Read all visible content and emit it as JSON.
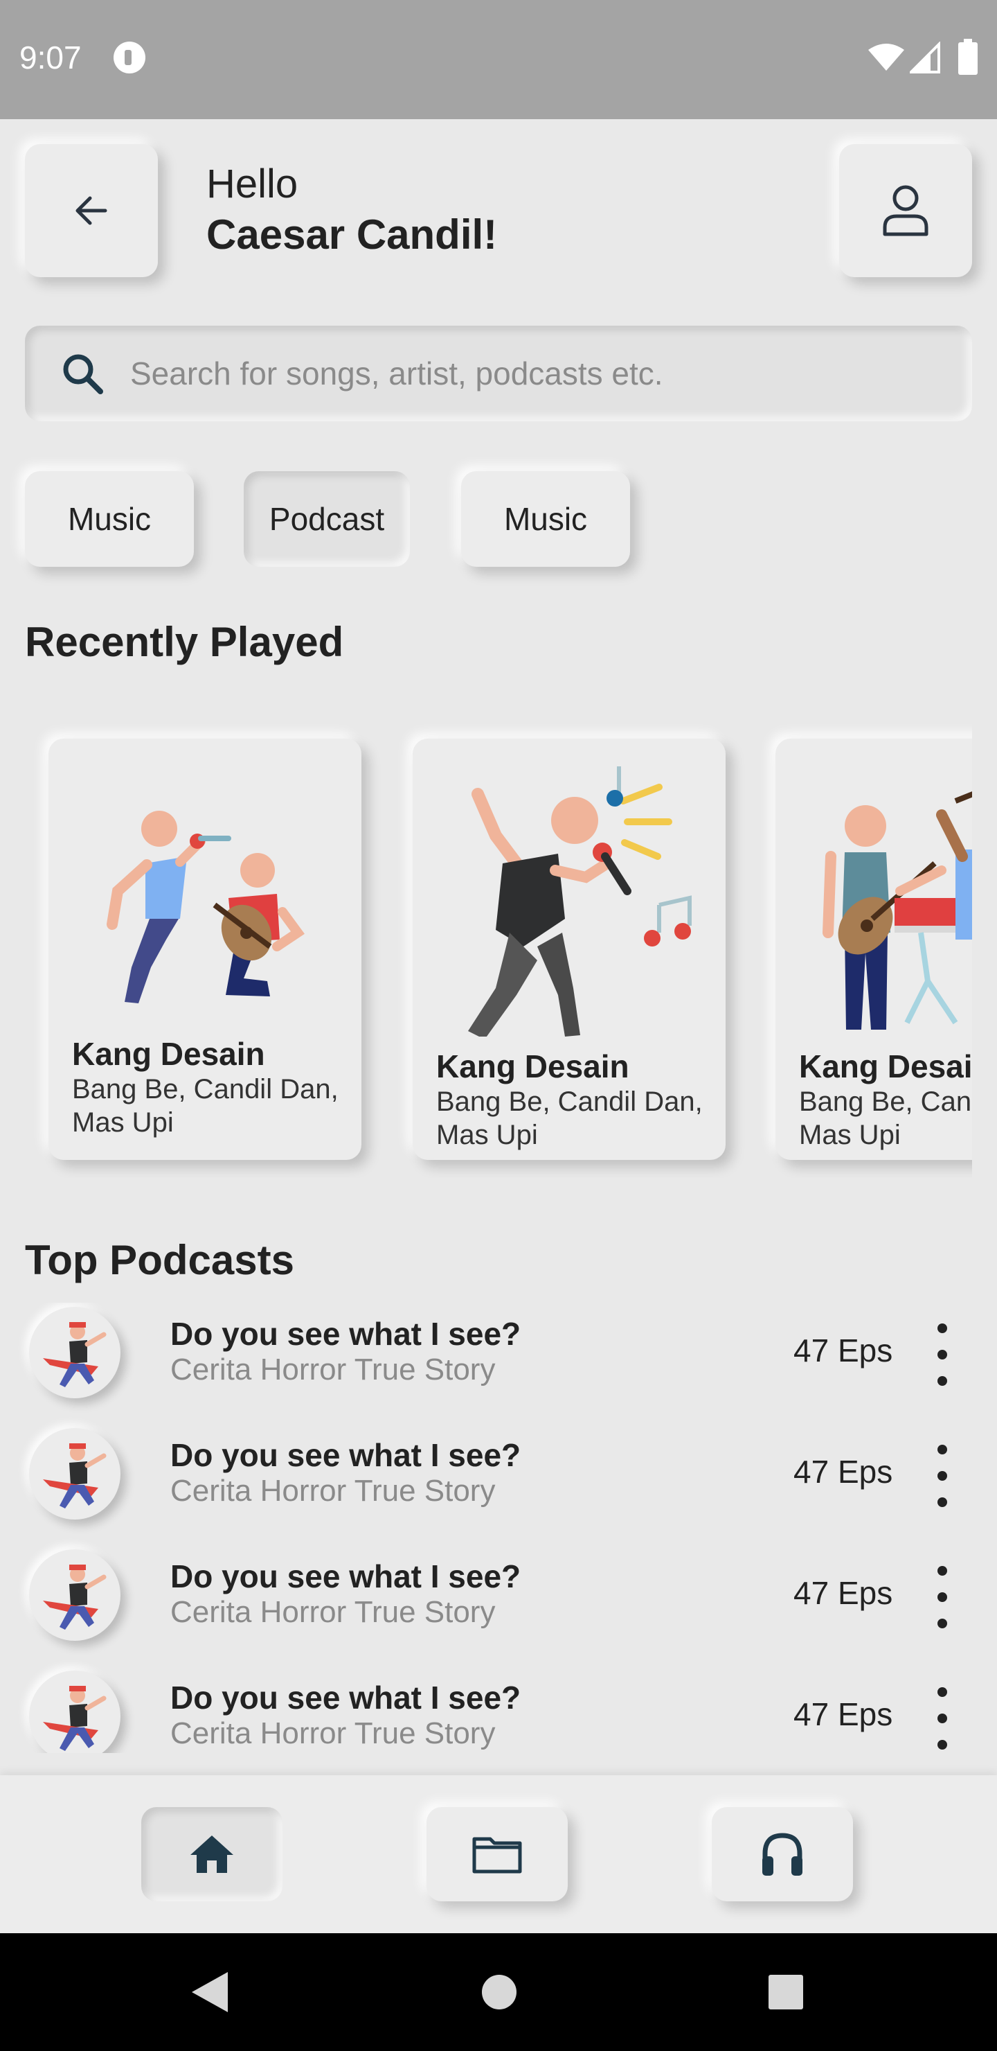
{
  "status_bar": {
    "time": "9:07",
    "icons": [
      "wifi-icon",
      "signal-icon",
      "battery-icon"
    ]
  },
  "header": {
    "greeting": "Hello",
    "user_name": "Caesar Candil!"
  },
  "search": {
    "placeholder": "Search for songs, artist, podcasts etc."
  },
  "chips": [
    {
      "label": "Music",
      "selected": false
    },
    {
      "label": "Podcast",
      "selected": true
    },
    {
      "label": "Music",
      "selected": false
    }
  ],
  "recently_played": {
    "title": "Recently Played",
    "items": [
      {
        "title": "Kang Desain",
        "artists": "Bang Be, Candil Dan, Mas Upi"
      },
      {
        "title": "Kang Desain",
        "artists": "Bang Be, Candil Dan, Mas Upi"
      },
      {
        "title": "Kang Desain",
        "artists": "Bang Be, Candil Dan, Mas Upi"
      }
    ]
  },
  "top_podcasts": {
    "title": "Top Podcasts",
    "items": [
      {
        "title": "Do you see what I see?",
        "subtitle": "Cerita Horror True Story",
        "episodes": "47 Eps"
      },
      {
        "title": "Do you see what I see?",
        "subtitle": "Cerita Horror True Story",
        "episodes": "47 Eps"
      },
      {
        "title": "Do you see what I see?",
        "subtitle": "Cerita Horror True Story",
        "episodes": "47 Eps"
      },
      {
        "title": "Do you see what I see?",
        "subtitle": "Cerita Horror True Story",
        "episodes": "47 Eps"
      }
    ]
  },
  "bottom_nav": {
    "items": [
      "home-icon",
      "folder-icon",
      "headphones-icon"
    ],
    "active": "home-icon"
  },
  "colors": {
    "background": "#e9e9e9",
    "status_bar": "#a4a4a4",
    "icon_dark": "#1f3a4a",
    "text": "#222222",
    "muted": "#8a8a8a"
  }
}
